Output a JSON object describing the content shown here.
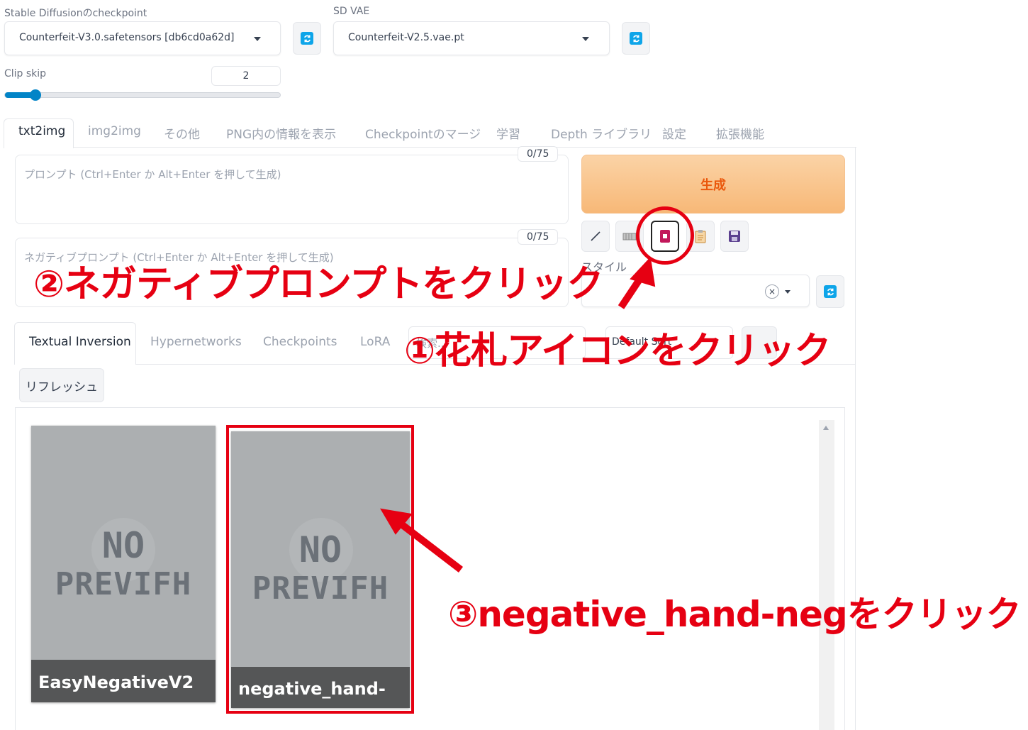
{
  "checkpoint": {
    "label": "Stable Diffusionのcheckpoint",
    "value": "Counterfeit-V3.0.safetensors [db6cd0a62d]"
  },
  "vae": {
    "label": "SD VAE",
    "value": "Counterfeit-V2.5.vae.pt"
  },
  "clip_skip": {
    "label": "Clip skip",
    "value": "2",
    "slider_level": 0.11
  },
  "tabs": [
    {
      "label": "txt2img",
      "active": true
    },
    {
      "label": "img2img"
    },
    {
      "label": "その他"
    },
    {
      "label": "PNG内の情報を表示"
    },
    {
      "label": "Checkpointのマージ"
    },
    {
      "label": "学習"
    },
    {
      "label": "Depth ライブラリ"
    },
    {
      "label": "設定"
    },
    {
      "label": "拡張機能"
    }
  ],
  "prompt": {
    "placeholder": "プロンプト (Ctrl+Enter か Alt+Enter を押して生成)",
    "counter": "0/75"
  },
  "negative_prompt": {
    "placeholder": "ネガティブプロンプト (Ctrl+Enter か Alt+Enter を押して生成)",
    "counter": "0/75"
  },
  "generate_label": "生成",
  "style": {
    "label": "スタイル",
    "clear": "×"
  },
  "network_tabs": [
    {
      "label": "Textual Inversion",
      "active": true
    },
    {
      "label": "Hypernetworks"
    },
    {
      "label": "Checkpoints"
    },
    {
      "label": "LoRA"
    }
  ],
  "search_placeholder": "検索...",
  "sort_value": "Default Sort",
  "refresh_label": "リフレッシュ",
  "cards": [
    {
      "name": "EasyNegativeV2",
      "preview_line1": "NO",
      "preview_line2": "PREVIFH"
    },
    {
      "name": "negative_hand-neg",
      "preview_line1": "NO",
      "preview_line2": "PREVIFH"
    }
  ],
  "annotations": {
    "step1": "①花札アイコンをクリック",
    "step2": "②ネガティブプロンプトをクリック",
    "step3": "③negative_hand-negをクリック"
  },
  "colors": {
    "annotation_red": "#e60012",
    "generate_orange": "#f9c08a",
    "generate_text": "#ea580c",
    "refresh_blue": "#0ea5e9",
    "card_bg": "#acafb1"
  },
  "icons": [
    "refresh-icon",
    "pencil-icon",
    "trash-icon",
    "hanafuda-card-icon",
    "clipboard-icon",
    "save-icon",
    "close-icon",
    "chevron-down-icon",
    "scroll-up-arrow-icon"
  ]
}
